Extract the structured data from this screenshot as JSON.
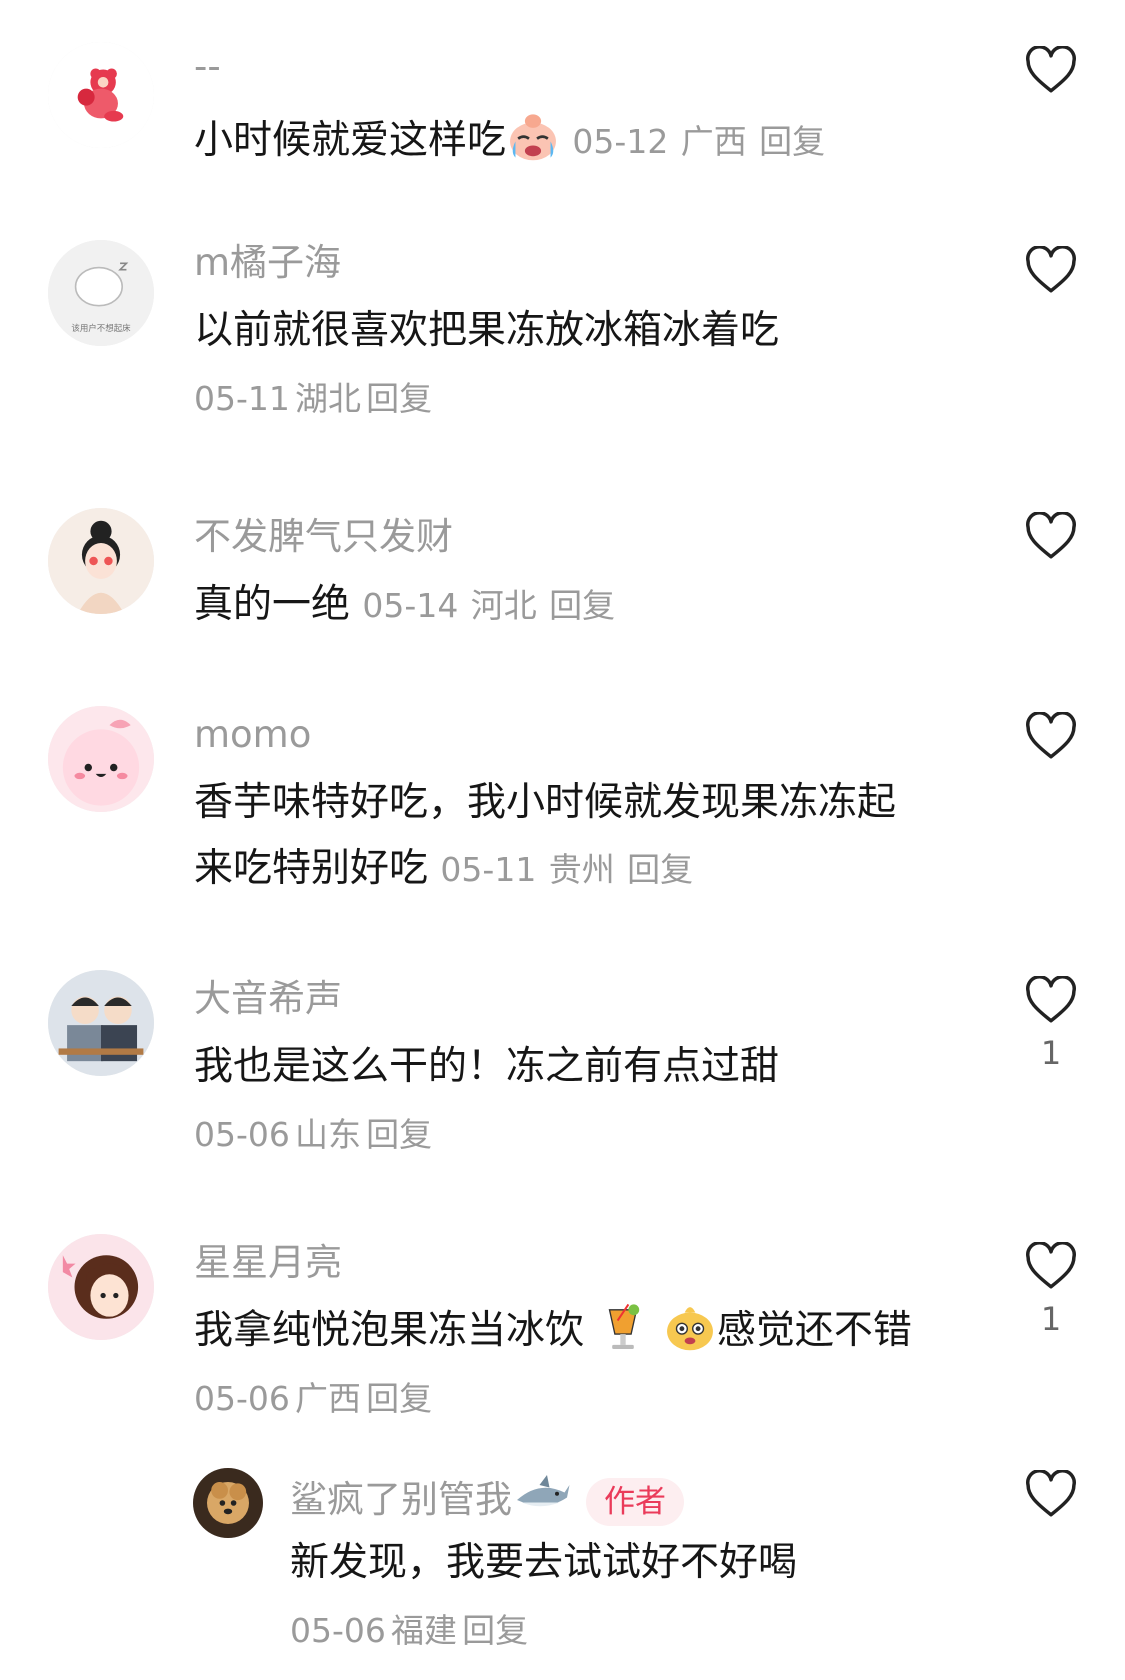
{
  "comments": [
    {
      "username": "--",
      "text": "小时候就爱这样吃",
      "emoji": "crying-face-emoji",
      "date": "05-12",
      "location": "广西",
      "reply_label": "回复"
    },
    {
      "username": "m橘子海",
      "text": "以前就很喜欢把果冻放冰箱冰着吃",
      "date": "05-11",
      "location": "湖北",
      "reply_label": "回复",
      "avatar_caption": "该用户不想起床"
    },
    {
      "username": "不发脾气只发财",
      "text": "真的一绝",
      "date": "05-14",
      "location": "河北",
      "reply_label": "回复"
    },
    {
      "username": "momo",
      "text_line1": "香芋味特好吃，我小时候就发现果冻冻起",
      "text_line2": "来吃特别好吃",
      "date": "05-11",
      "location": "贵州",
      "reply_label": "回复"
    },
    {
      "username": "大音希声",
      "text": "我也是这么干的！冻之前有点过甜",
      "date": "05-06",
      "location": "山东",
      "reply_label": "回复",
      "likes": "1"
    },
    {
      "username": "星星月亮",
      "text_part1": "我拿纯悦泡果冻当冰饮",
      "emoji1": "cocktail-emoji",
      "emoji2": "smiling-face-emoji",
      "text_part2": "感觉还不错",
      "date": "05-06",
      "location": "广西",
      "reply_label": "回复",
      "likes": "1"
    }
  ],
  "reply": {
    "username": "鲨疯了别管我",
    "username_emoji": "shark-emoji",
    "badge": "作者",
    "text": "新发现，我要去试试好不好喝",
    "date": "05-06",
    "location": "福建",
    "reply_label": "回复"
  },
  "icons": {
    "like": "heart-outline-icon"
  },
  "colors": {
    "text": "#161616",
    "muted": "#9a9a9a",
    "badge_text": "#ea3b5a",
    "badge_bg": "#fdeef0"
  }
}
